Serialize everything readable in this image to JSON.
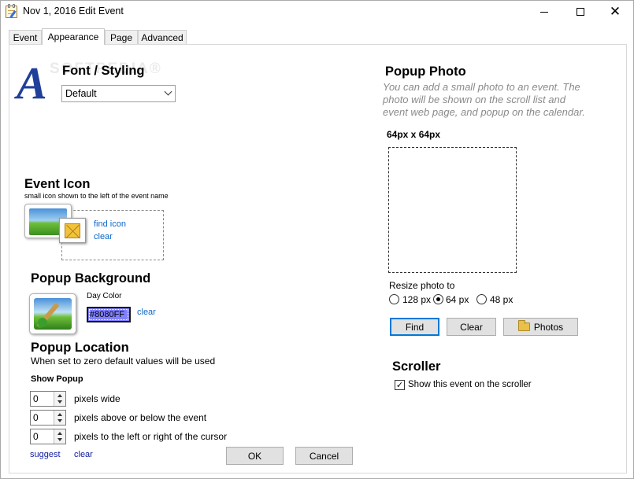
{
  "window": {
    "title": "Nov 1, 2016 Edit Event"
  },
  "tabs": [
    {
      "label": "Event"
    },
    {
      "label": "Appearance",
      "active": true
    },
    {
      "label": "Page"
    },
    {
      "label": "Advanced"
    }
  ],
  "font_styling": {
    "title": "Font / Styling",
    "selected": "Default",
    "watermark": "SOFTPEDIA®"
  },
  "event_icon": {
    "title": "Event Icon",
    "subtitle": "small icon shown to the left of the event name",
    "find_label": "find icon",
    "clear_label": "clear"
  },
  "popup_background": {
    "title": "Popup Background",
    "day_color_label": "Day Color",
    "color_value": "#8080FF",
    "clear_label": "clear"
  },
  "popup_location": {
    "title": "Popup Location",
    "note": "When set to zero default values will be used",
    "show_popup_label": "Show Popup",
    "fields": [
      {
        "value": "0",
        "label": "pixels wide"
      },
      {
        "value": "0",
        "label": "pixels above or below the event"
      },
      {
        "value": "0",
        "label": "pixels to the left or right of the cursor"
      }
    ],
    "suggest_label": "suggest",
    "clear_label": "clear"
  },
  "popup_photo": {
    "title": "Popup Photo",
    "description": "You can add a small photo to an event. The photo will be shown on the scroll list and event web page, and popup on the calendar.",
    "size_label": "64px x 64px",
    "resize_label": "Resize photo to",
    "resize_options": [
      {
        "label": "128 px",
        "selected": false
      },
      {
        "label": "64 px",
        "selected": true
      },
      {
        "label": "48 px",
        "selected": false
      }
    ],
    "find_button": "Find",
    "clear_button": "Clear",
    "photos_button": "Photos"
  },
  "scroller": {
    "title": "Scroller",
    "checkbox_label": "Show this event on the scroller",
    "checked": true
  },
  "dialog_buttons": {
    "ok": "OK",
    "cancel": "Cancel"
  },
  "colors": {
    "accent": "#0078d7",
    "link": "#0a66c8",
    "swatch": "#8080ff",
    "logo": "#1f3f9a"
  }
}
